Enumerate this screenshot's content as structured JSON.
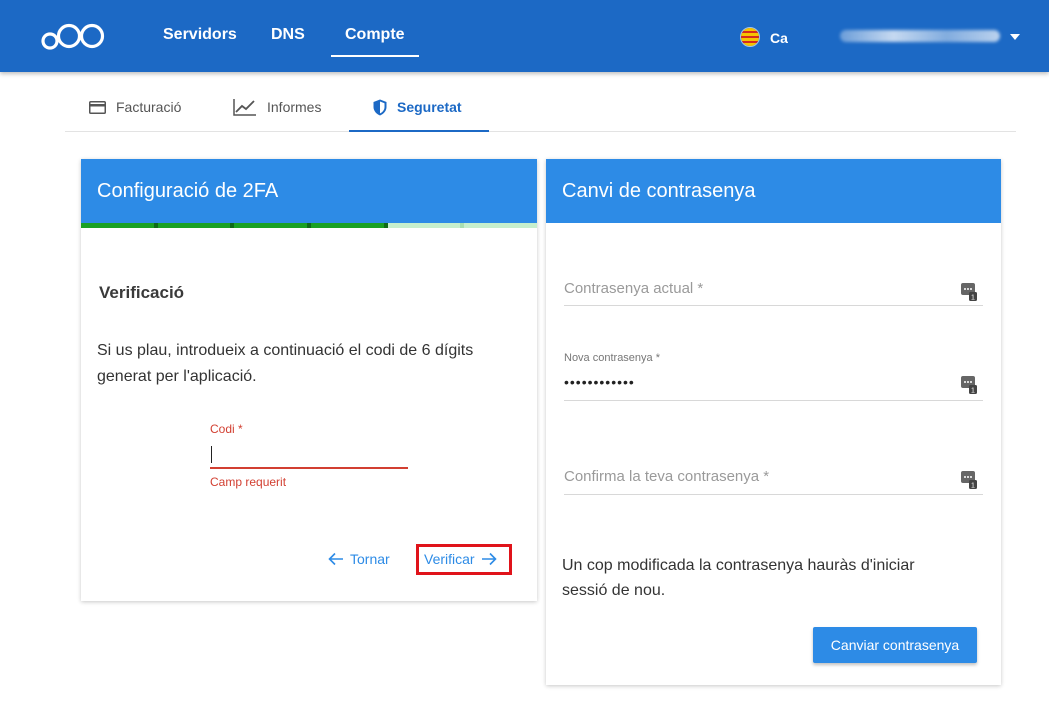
{
  "topbar": {
    "nav": [
      {
        "label": "Servidors",
        "active": false
      },
      {
        "label": "DNS",
        "active": false
      },
      {
        "label": "Compte",
        "active": true
      }
    ],
    "language": "Ca",
    "colors": {
      "bar": "#1c69c5"
    }
  },
  "subtabs": [
    {
      "label": "Facturació",
      "icon": "credit-card-icon",
      "active": false
    },
    {
      "label": "Informes",
      "icon": "chart-line-icon",
      "active": false
    },
    {
      "label": "Seguretat",
      "icon": "shield-icon",
      "active": true
    }
  ],
  "twofa": {
    "title": "Configuració de 2FA",
    "step_title": "Verificació",
    "instructions": "Si us plau, introdueix a continuació el codi de 6 dígits generat per l'aplicació.",
    "progress": {
      "completed_steps": 4,
      "total_steps": 6
    },
    "code_field": {
      "label": "Codi *",
      "value": "",
      "error": "Camp requerit"
    },
    "back_label": "Tornar",
    "verify_label": "Verificar"
  },
  "password": {
    "title": "Canvi de contrasenya",
    "current_placeholder": "Contrasenya actual *",
    "new_label": "Nova contrasenya *",
    "new_value": "••••••••••••",
    "confirm_placeholder": "Confirma la teva contrasenya *",
    "note": "Un cop modificada la contrasenya hauràs d'iniciar sessió de nou.",
    "submit_label": "Canviar contrasenya"
  }
}
